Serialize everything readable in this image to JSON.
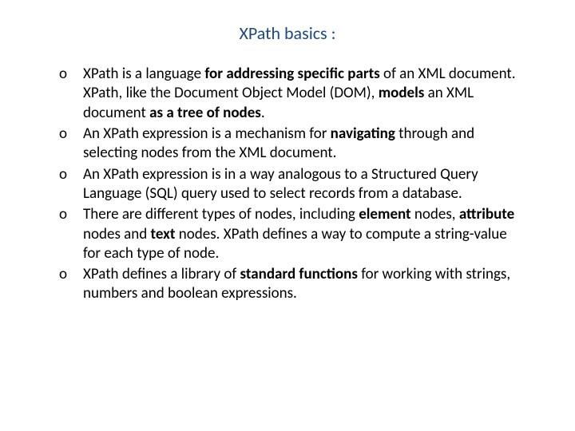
{
  "title": "XPath basics :",
  "marker": "o",
  "bullets": [
    {
      "t0": "XPath is a language ",
      "b0": "for addressing specific parts",
      "t1": " of an XML document. XPath, like the Document Object Model (DOM), ",
      "b1": "models",
      "t2": " an XML document ",
      "b2": "as a tree of nodes",
      "t3": "."
    },
    {
      "t0": "An XPath expression is a mechanism for ",
      "b0": "navigating",
      "t1": " through and selecting nodes from the XML document."
    },
    {
      "t0": "An XPath expression is in a way analogous to a Structured Query Language (SQL) query used to select records from a database."
    },
    {
      "t0": "There are different types of nodes, including ",
      "b0": "element",
      "t1": " nodes, ",
      "b1": "attribute",
      "t2": " nodes and ",
      "b2": "text",
      "t3": " nodes. XPath defines a way to compute a string-value for each type of node."
    },
    {
      "t0": "XPath defines a library of ",
      "b0": "standard functions",
      "t1": " for working with strings, numbers and boolean expressions."
    }
  ]
}
